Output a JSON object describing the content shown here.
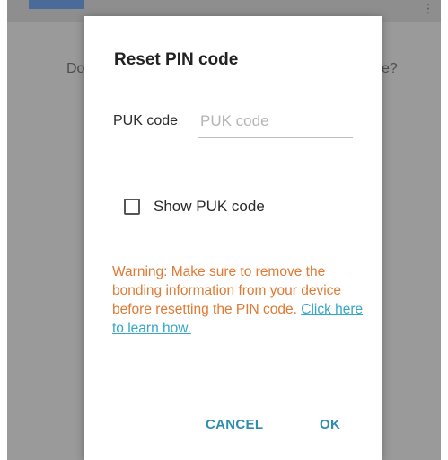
{
  "background": {
    "title": "",
    "question_left": "Do",
    "question_right": "e?",
    "menu_glyph": "⋮"
  },
  "dialog": {
    "title": "Reset PIN code",
    "puk_label": "PUK code",
    "puk_placeholder": "PUK code",
    "puk_value": "",
    "show_puk_label": "Show PUK code",
    "show_puk_checked": false,
    "warning_text": "Warning: Make sure to remove the bonding information from your device before resetting the PIN code.",
    "link_text": "Click here to learn how.",
    "cancel_label": "CANCEL",
    "ok_label": "OK"
  },
  "colors": {
    "warning": "#e07a35",
    "link": "#35a7c7",
    "button": "#2f8bb0"
  }
}
